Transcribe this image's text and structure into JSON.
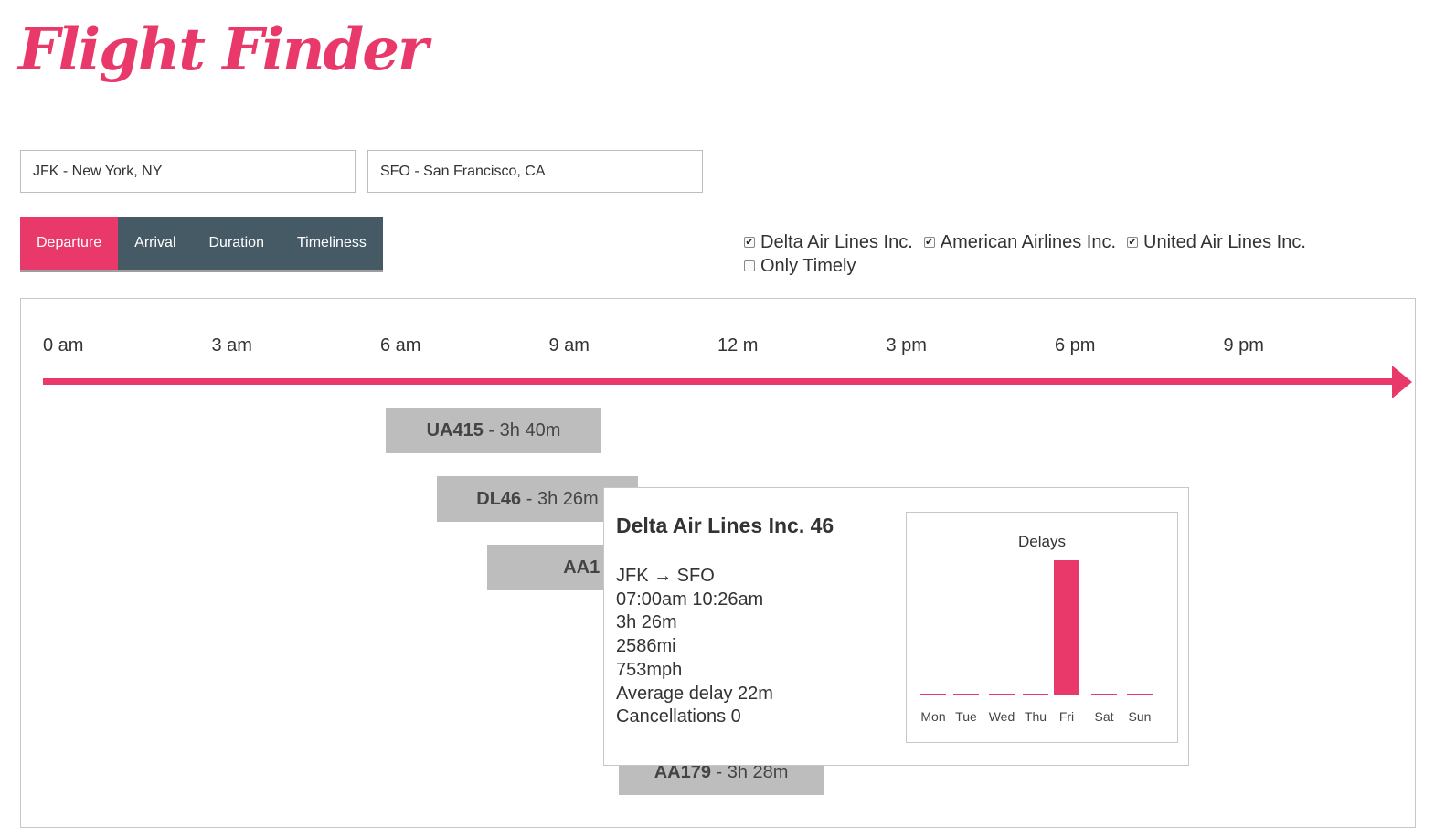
{
  "app": {
    "logo": "Flight Finder"
  },
  "search": {
    "origin": "JFK - New York, NY",
    "destination": "SFO - San Francisco, CA"
  },
  "tabs": [
    {
      "label": "Departure",
      "active": true
    },
    {
      "label": "Arrival",
      "active": false
    },
    {
      "label": "Duration",
      "active": false
    },
    {
      "label": "Timeliness",
      "active": false
    }
  ],
  "filters": {
    "airlines": [
      {
        "label": "Delta Air Lines Inc.",
        "checked": true
      },
      {
        "label": "American Airlines Inc.",
        "checked": true
      },
      {
        "label": "United Air Lines Inc.",
        "checked": true
      }
    ],
    "only_timely": {
      "label": "Only Timely",
      "checked": false
    }
  },
  "timeline": {
    "ticks": [
      "0 am",
      "3 am",
      "6 am",
      "9 am",
      "12 m",
      "3 pm",
      "6 pm",
      "9 pm"
    ],
    "flights": [
      {
        "code": "UA415",
        "duration": " - 3h 40m",
        "depart_hour": 6.1,
        "duration_hours": 3.67
      },
      {
        "code": "DL46",
        "duration": " - 3h 26m",
        "depart_hour": 7.0,
        "duration_hours": 3.43
      },
      {
        "code": "AA1",
        "duration": "",
        "depart_hour": 7.9,
        "duration_hours": 3.2
      },
      {
        "code": "AA179",
        "duration": " - 3h 28m",
        "depart_hour": 10.25,
        "duration_hours": 3.47
      }
    ]
  },
  "tooltip": {
    "title": "Delta Air Lines Inc. 46",
    "route": "JFK → SFO",
    "times": "07:00am 10:26am",
    "duration": "3h 26m",
    "distance": "2586mi",
    "speed": "753mph",
    "avg_delay": "Average delay 22m",
    "cancellations": "Cancellations 0"
  },
  "chart_data": {
    "type": "bar",
    "title": "Delays",
    "categories": [
      "Mon",
      "Tue",
      "Wed",
      "Thu",
      "Fri",
      "Sat",
      "Sun"
    ],
    "values": [
      0,
      0,
      0,
      0,
      22,
      0,
      0
    ],
    "bar_color": "#e8396a"
  },
  "colors": {
    "accent": "#e8396a",
    "tab_bg": "#455a64",
    "flight_bar": "#bdbdbd"
  }
}
